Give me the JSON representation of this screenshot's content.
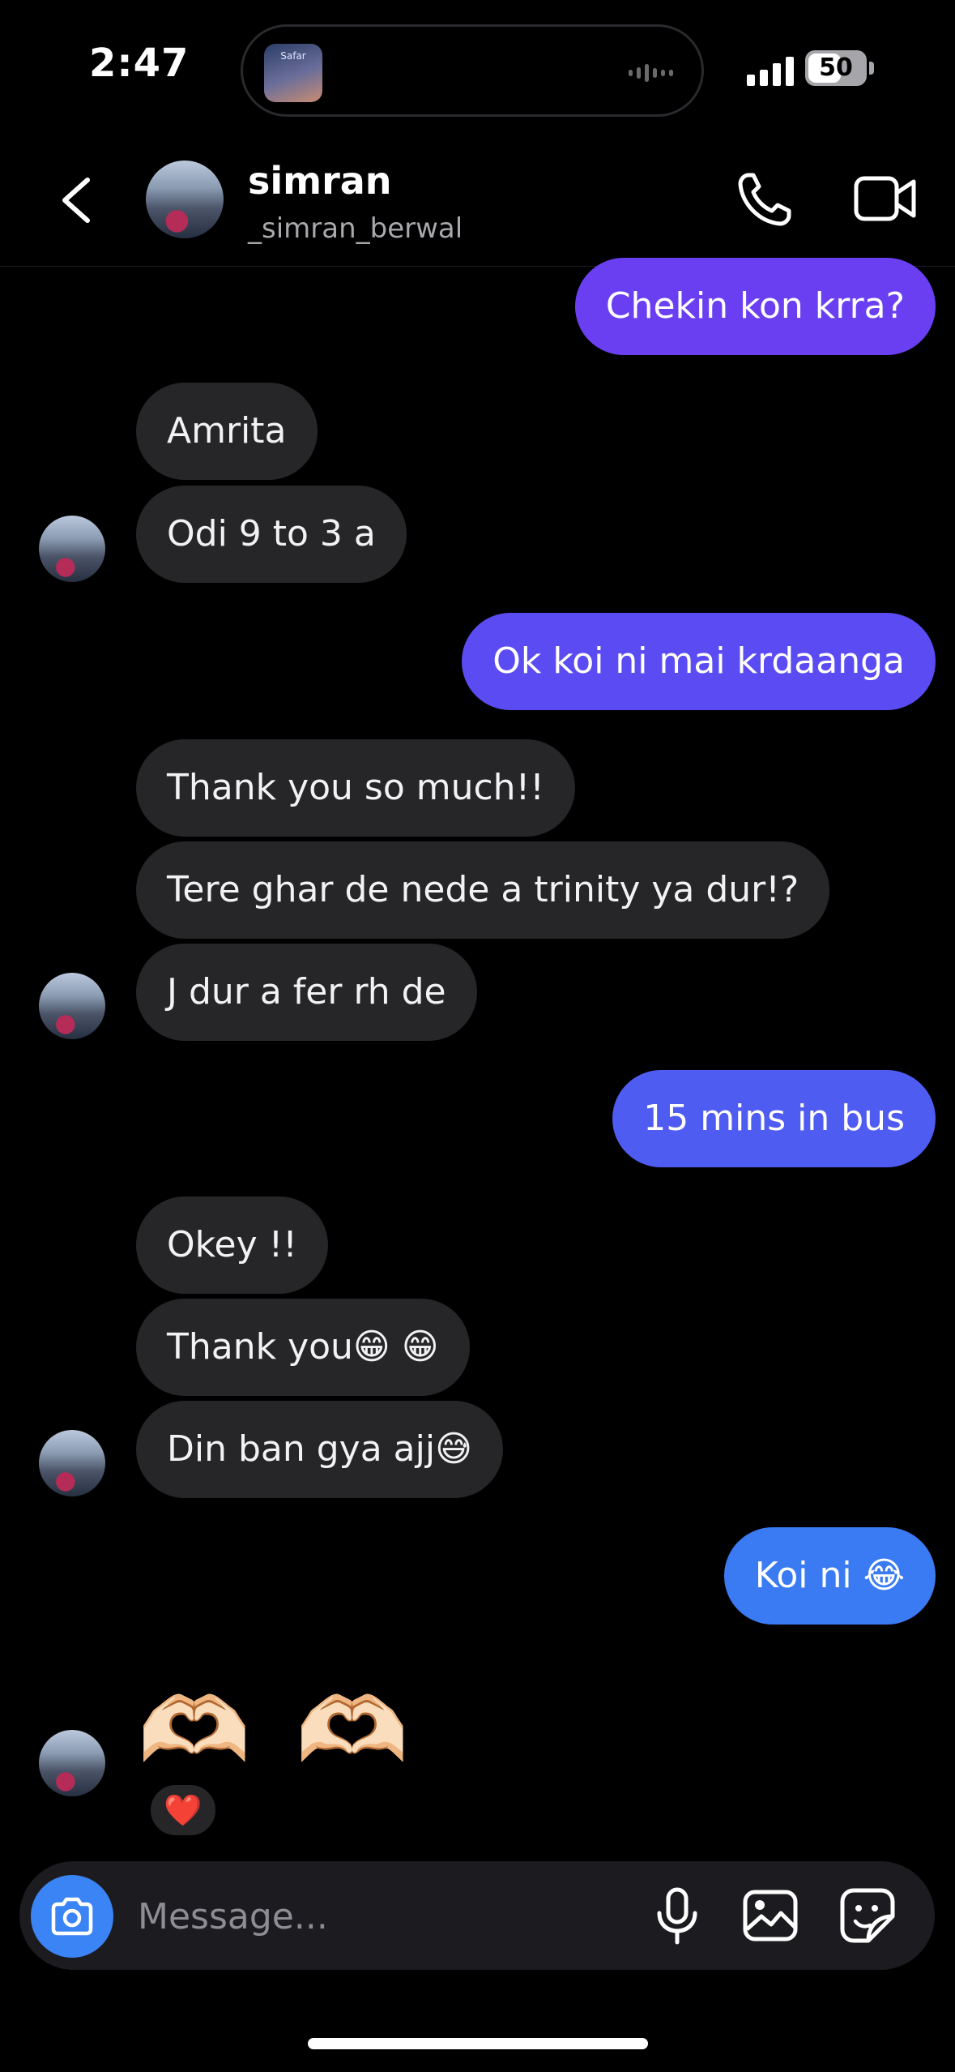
{
  "status_bar": {
    "time": "2:47",
    "battery": "50",
    "island_art_text": "Safar"
  },
  "header": {
    "name": "simran",
    "username": "_simran_berwal",
    "icons": [
      "chevron-left-icon",
      "phone-icon",
      "video-camera-icon"
    ]
  },
  "colors": {
    "incoming_bubble": "#262629",
    "outgoing_purple": "#6a3ff2",
    "outgoing_blue": "#3a7af2",
    "camera_button": "#3a84f5"
  },
  "messages": [
    {
      "side": "out",
      "text": "Chekin kon krra?"
    },
    {
      "side": "in",
      "text": "Amrita"
    },
    {
      "side": "in",
      "text": "Odi 9 to 3 a"
    },
    {
      "side": "out",
      "text": "Ok koi ni mai krdaanga"
    },
    {
      "side": "in",
      "text": "Thank you so much!!"
    },
    {
      "side": "in",
      "text": "Tere ghar de nede a trinity ya dur!?"
    },
    {
      "side": "in",
      "text": "J dur a fer rh de"
    },
    {
      "side": "out",
      "text": "15 mins in bus"
    },
    {
      "side": "in",
      "text": "Okey !!"
    },
    {
      "side": "in",
      "text": "Thank you😁 😁"
    },
    {
      "side": "in",
      "text": "Din ban gya ajj😅"
    },
    {
      "side": "out",
      "text": "Koi ni 😂"
    },
    {
      "side": "in",
      "text": "🫶🏻 🫶🏻",
      "reaction": "❤️"
    }
  ],
  "composer": {
    "placeholder": "Message...",
    "icons": [
      "camera-icon",
      "microphone-icon",
      "gallery-icon",
      "sticker-icon"
    ]
  }
}
